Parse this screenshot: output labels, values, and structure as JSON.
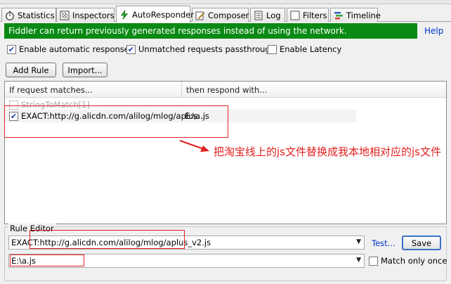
{
  "tabs": [
    {
      "label": "Statistics",
      "icon": "stopwatch-icon"
    },
    {
      "label": "Inspectors",
      "icon": "inspect-icon"
    },
    {
      "label": "AutoResponder",
      "icon": "lightning-icon",
      "active": true
    },
    {
      "label": "Composer",
      "icon": "compose-icon"
    },
    {
      "label": "Log",
      "icon": "log-icon"
    },
    {
      "label": "Filters",
      "icon": "filter-icon"
    },
    {
      "label": "Timeline",
      "icon": "timeline-icon"
    }
  ],
  "banner": {
    "text": "Fiddler can return previously generated responses instead of using the network.",
    "help": "Help",
    "color": "#0a8a14"
  },
  "options": {
    "enable_auto": {
      "label": "Enable automatic responses",
      "checked": true
    },
    "unmatched": {
      "label": "Unmatched requests passthrough",
      "checked": true
    },
    "latency": {
      "label": "Enable Latency",
      "checked": false
    }
  },
  "buttons": {
    "add_rule": "Add Rule",
    "import": "Import..."
  },
  "list": {
    "col1": "If request matches...",
    "col2": "then respond with...",
    "rows": [
      {
        "match": "StringToMatch[1]",
        "respond": "",
        "checked": false,
        "placeholder": true
      },
      {
        "match": "EXACT:http://g.alicdn.com/alilog/mlog/aplus...",
        "respond": "E:\\a.js",
        "checked": true,
        "placeholder": false
      }
    ]
  },
  "annotation": {
    "text": "把淘宝线上的js文件替换成我本地相对应的js文件",
    "color": "#e0201e"
  },
  "rule_editor": {
    "label": "Rule Editor",
    "match_value": "EXACT:http://g.alicdn.com/alilog/mlog/aplus_v2.js",
    "respond_value": "E:\\a.js",
    "test": "Test...",
    "save": "Save",
    "match_once": {
      "label": "Match only once",
      "checked": false
    }
  }
}
